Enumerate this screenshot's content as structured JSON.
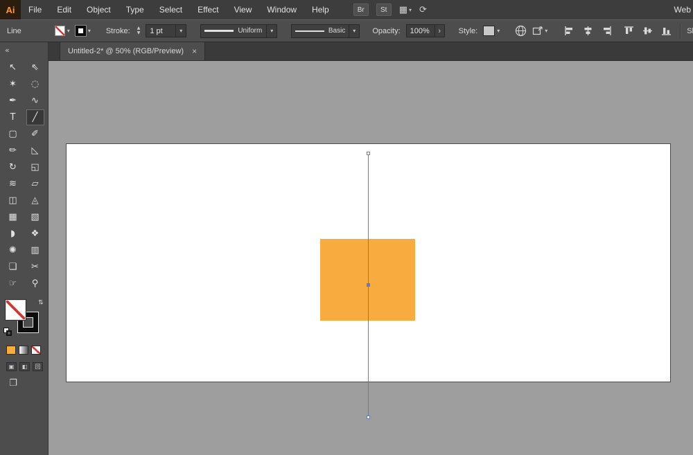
{
  "app": {
    "logo_text": "Ai",
    "workspace": "Web"
  },
  "menubar": {
    "items": [
      "File",
      "Edit",
      "Object",
      "Type",
      "Select",
      "Effect",
      "View",
      "Window",
      "Help"
    ],
    "bridge": "Br",
    "stock": "St"
  },
  "controlbar": {
    "tool_name": "Line",
    "stroke_label": "Stroke:",
    "stroke_weight": "1 pt",
    "variable_width_profile": "Uniform",
    "brush_definition": "Basic",
    "opacity_label": "Opacity:",
    "opacity_value": "100%",
    "style_label": "Style:",
    "shape_label": "Shape:"
  },
  "tabbar": {
    "document_title": "Untitled-2* @ 50% (RGB/Preview)",
    "close_glyph": "×",
    "zoom_level": "50%"
  },
  "toolbar": {
    "collapse_glyph": "«",
    "tools": [
      {
        "name": "selection-tool",
        "glyph": "↖",
        "selected": false
      },
      {
        "name": "direct-selection-tool",
        "glyph": "⇖",
        "selected": false
      },
      {
        "name": "magic-wand-tool",
        "glyph": "✶",
        "selected": false
      },
      {
        "name": "lasso-tool",
        "glyph": "◌",
        "selected": false
      },
      {
        "name": "pen-tool",
        "glyph": "✒",
        "selected": false
      },
      {
        "name": "curvature-tool",
        "glyph": "∿",
        "selected": false
      },
      {
        "name": "type-tool",
        "glyph": "T",
        "selected": false
      },
      {
        "name": "line-segment-tool",
        "glyph": "╱",
        "selected": true
      },
      {
        "name": "rectangle-tool",
        "glyph": "▢",
        "selected": false
      },
      {
        "name": "paintbrush-tool",
        "glyph": "✐",
        "selected": false
      },
      {
        "name": "pencil-tool",
        "glyph": "✏",
        "selected": false
      },
      {
        "name": "eraser-tool",
        "glyph": "◺",
        "selected": false
      },
      {
        "name": "rotate-tool",
        "glyph": "↻",
        "selected": false
      },
      {
        "name": "scale-tool",
        "glyph": "◱",
        "selected": false
      },
      {
        "name": "width-tool",
        "glyph": "≋",
        "selected": false
      },
      {
        "name": "free-transform-tool",
        "glyph": "▱",
        "selected": false
      },
      {
        "name": "shape-builder-tool",
        "glyph": "◫",
        "selected": false
      },
      {
        "name": "perspective-grid-tool",
        "glyph": "◬",
        "selected": false
      },
      {
        "name": "mesh-tool",
        "glyph": "▦",
        "selected": false
      },
      {
        "name": "gradient-tool",
        "glyph": "▧",
        "selected": false
      },
      {
        "name": "eyedropper-tool",
        "glyph": "◗",
        "selected": false
      },
      {
        "name": "blend-tool",
        "glyph": "❖",
        "selected": false
      },
      {
        "name": "symbol-sprayer-tool",
        "glyph": "✺",
        "selected": false
      },
      {
        "name": "column-graph-tool",
        "glyph": "▥",
        "selected": false
      },
      {
        "name": "artboard-tool",
        "glyph": "❏",
        "selected": false
      },
      {
        "name": "slice-tool",
        "glyph": "✂",
        "selected": false
      },
      {
        "name": "hand-tool",
        "glyph": "☞",
        "selected": false
      },
      {
        "name": "zoom-tool",
        "glyph": "⚲",
        "selected": false
      }
    ]
  },
  "colors": {
    "artwork_orange": "#F8AC40",
    "selection_blue": "#4E7FE8",
    "none_red": "#DD3333"
  }
}
